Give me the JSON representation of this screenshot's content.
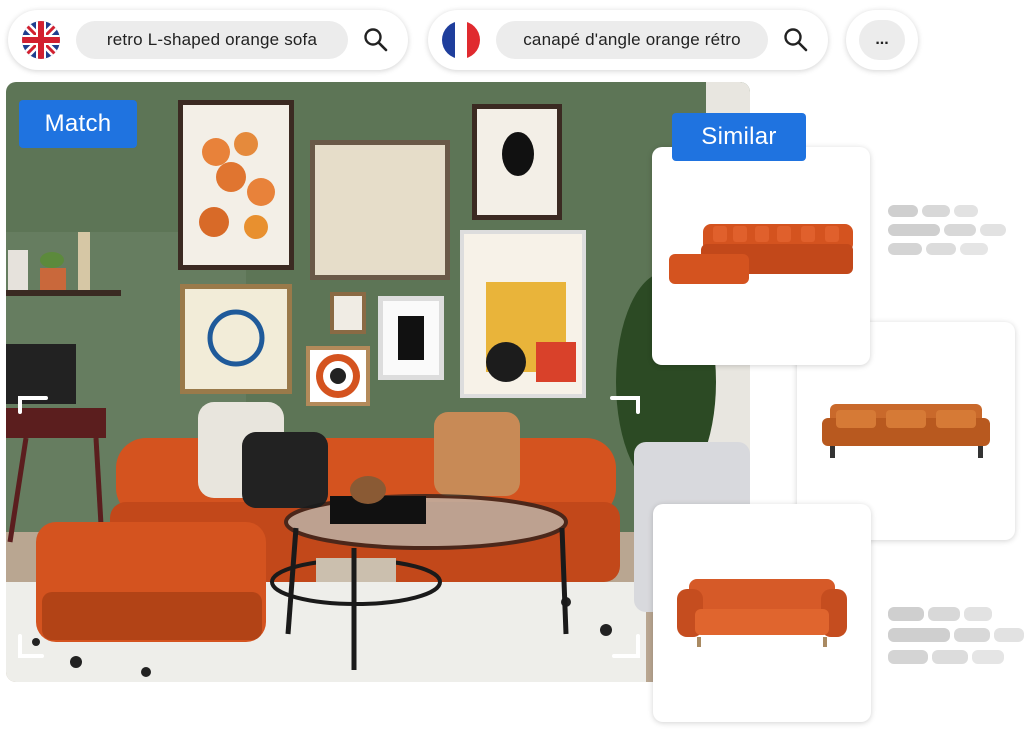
{
  "queries": [
    {
      "language": "English",
      "flag": "uk-flag-icon",
      "text": "retro L-shaped orange sofa"
    },
    {
      "language": "French",
      "flag": "france-flag-icon",
      "text": "canapé d'angle orange rétro"
    }
  ],
  "more_label": "...",
  "labels": {
    "match": "Match",
    "similar": "Similar"
  },
  "colors": {
    "accent": "#1f73e0",
    "wall": "#5d7556",
    "sofa": "#d4531f",
    "skeleton": "#d6d6d6"
  },
  "results": [
    {
      "type": "l-shaped sectional sofa",
      "color": "#d4531f"
    },
    {
      "type": "three-seat sofa with pillows",
      "color": "#c9692b"
    },
    {
      "type": "two-seat sofa",
      "color": "#d65a28"
    }
  ]
}
